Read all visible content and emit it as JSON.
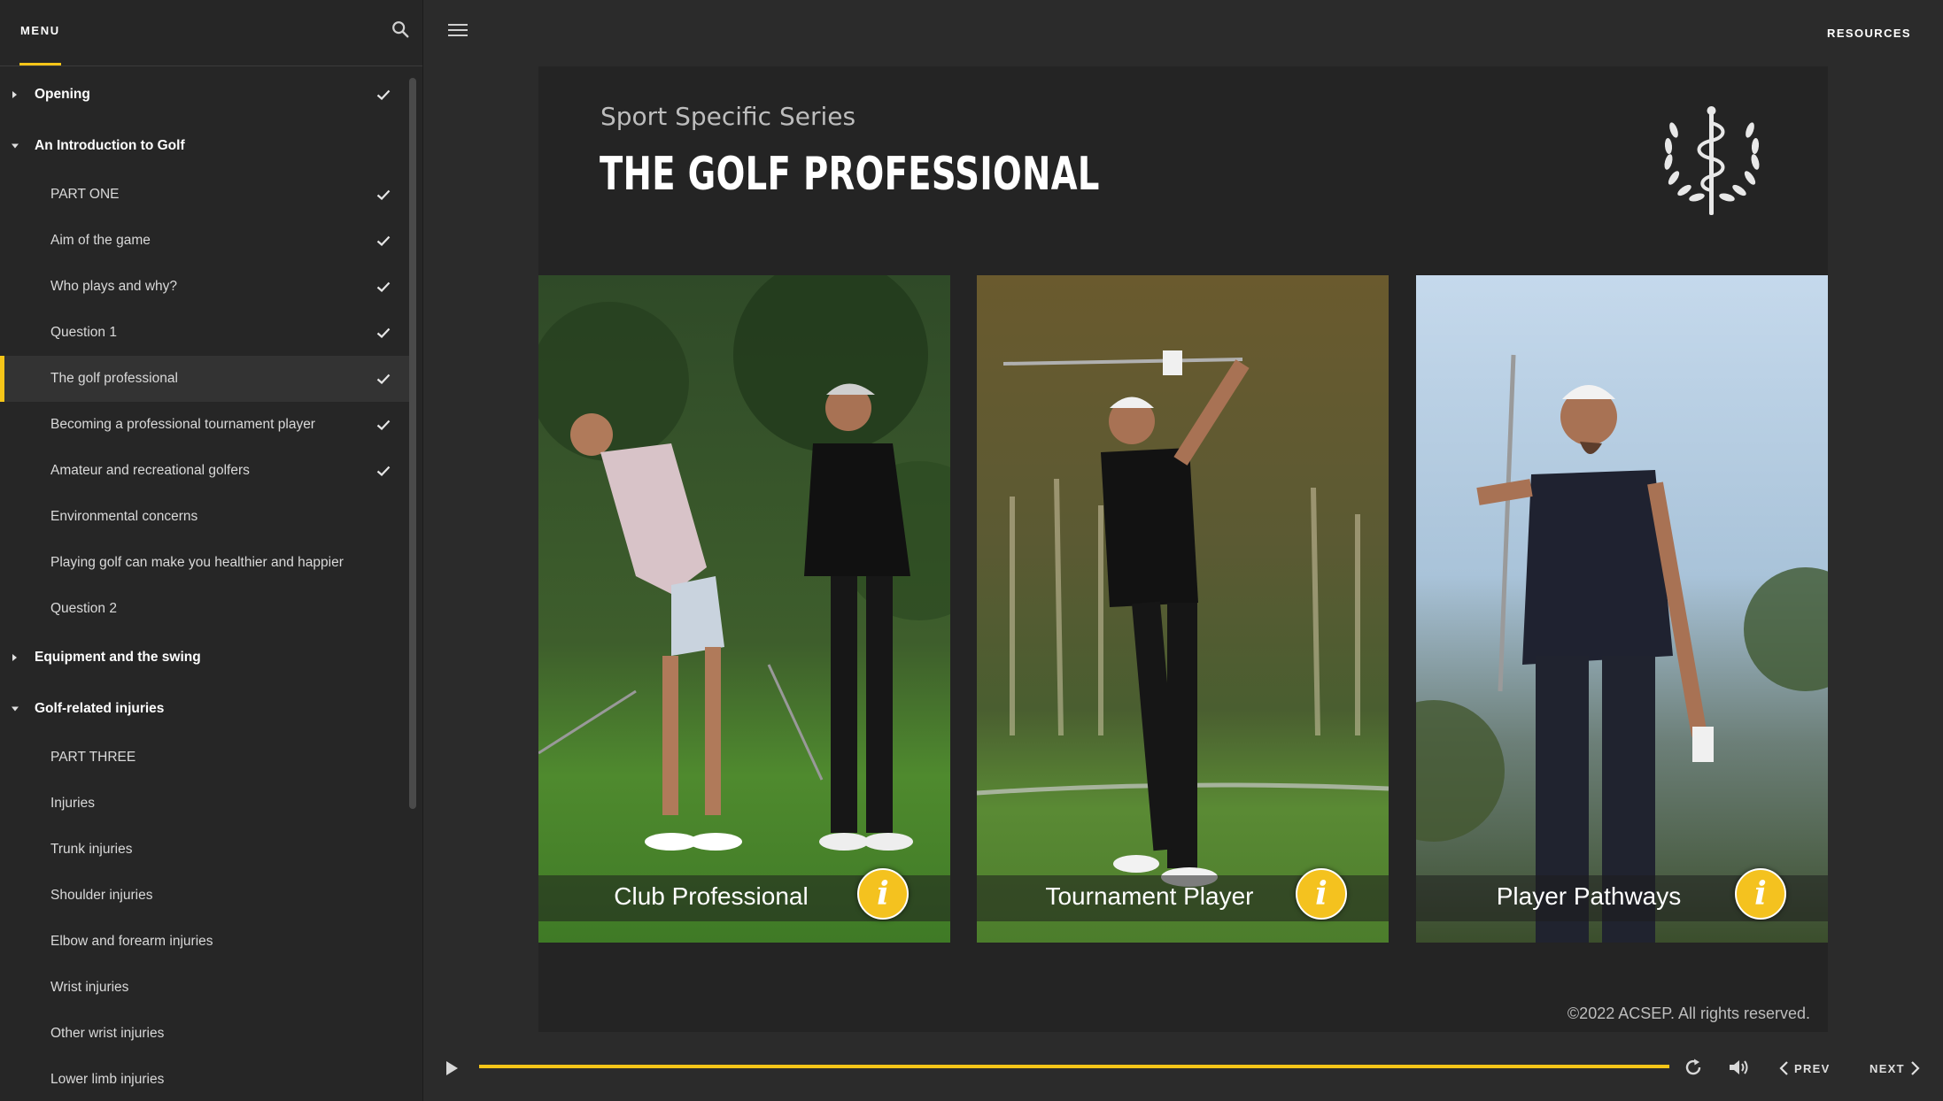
{
  "sidebar": {
    "menu_label": "MENU",
    "items": [
      {
        "label": "Opening",
        "type": "section",
        "expanded": false,
        "checked": true
      },
      {
        "label": "An Introduction to Golf",
        "type": "section",
        "expanded": true,
        "checked": false
      },
      {
        "label": "PART ONE",
        "type": "sub",
        "checked": true
      },
      {
        "label": "Aim of the game",
        "type": "sub",
        "checked": true
      },
      {
        "label": "Who plays and why?",
        "type": "sub",
        "checked": true
      },
      {
        "label": "Question 1",
        "type": "sub",
        "checked": true
      },
      {
        "label": "The golf professional",
        "type": "sub",
        "checked": true,
        "active": true
      },
      {
        "label": "Becoming a professional tournament player",
        "type": "sub",
        "checked": true
      },
      {
        "label": "Amateur and recreational golfers",
        "type": "sub",
        "checked": true
      },
      {
        "label": "Environmental concerns",
        "type": "sub",
        "checked": false
      },
      {
        "label": "Playing golf can make you healthier and happier",
        "type": "sub",
        "checked": false
      },
      {
        "label": "Question 2",
        "type": "sub",
        "checked": false
      },
      {
        "label": "Equipment and the swing",
        "type": "section",
        "expanded": false,
        "checked": false
      },
      {
        "label": "Golf-related injuries",
        "type": "section",
        "expanded": true,
        "checked": false
      },
      {
        "label": "PART THREE",
        "type": "sub",
        "checked": false
      },
      {
        "label": "Injuries",
        "type": "sub",
        "checked": false
      },
      {
        "label": "Trunk injuries",
        "type": "sub",
        "checked": false
      },
      {
        "label": "Shoulder injuries",
        "type": "sub",
        "checked": false
      },
      {
        "label": "Elbow and forearm injuries",
        "type": "sub",
        "checked": false
      },
      {
        "label": "Wrist injuries",
        "type": "sub",
        "checked": false
      },
      {
        "label": "Other wrist injuries",
        "type": "sub",
        "checked": false
      },
      {
        "label": "Lower limb injuries",
        "type": "sub",
        "checked": false
      }
    ]
  },
  "topbar": {
    "resources_label": "RESOURCES"
  },
  "slide": {
    "subtitle": "Sport Specific Series",
    "title": "THE GOLF PROFESSIONAL",
    "cards": [
      {
        "caption": "Club Professional",
        "info": "i"
      },
      {
        "caption": "Tournament Player",
        "info": "i"
      },
      {
        "caption": "Player Pathways",
        "info": "i"
      }
    ],
    "copyright": "©2022 ACSEP. All rights reserved."
  },
  "player": {
    "progress": 1.0,
    "prev_label": "PREV",
    "next_label": "NEXT"
  },
  "colors": {
    "accent": "#f5c518",
    "sidebar_bg": "#262626",
    "slide_bg": "#242424"
  }
}
